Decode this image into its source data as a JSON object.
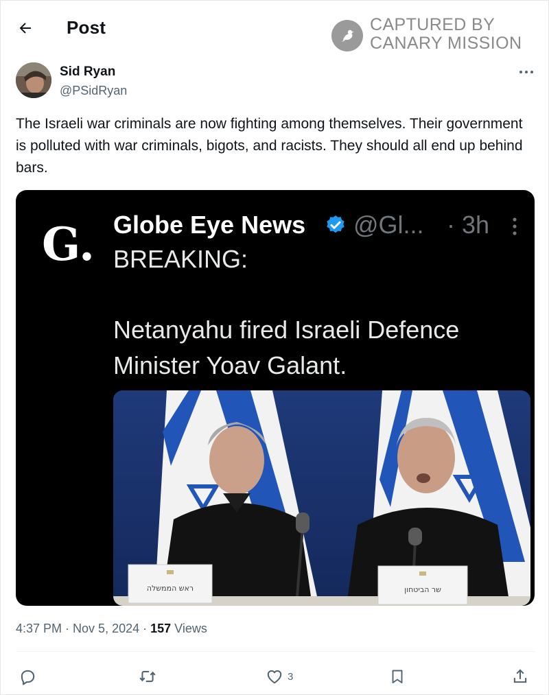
{
  "header": {
    "title": "Post",
    "back_icon": "arrow-left-icon"
  },
  "watermark": {
    "line1": "CAPTURED BY",
    "line2": "CANARY MISSION"
  },
  "author": {
    "name": "Sid Ryan",
    "handle": "@PSidRyan"
  },
  "post": {
    "text": "The Israeli war criminals are now fighting among themselves. Their government is polluted with  war criminals, bigots, and racists. They should all end up behind bars."
  },
  "embedded": {
    "logo": "G.",
    "name": "Globe Eye News",
    "handle": "@Gl...",
    "time": "· 3h",
    "breaking": "BREAKING:",
    "body": "Netanyahu fired Israeli Defence Minister Yoav Galant.",
    "placard_left": "ראש הממשלה",
    "placard_right": "שר הביטחון"
  },
  "meta": {
    "time": "4:37 PM",
    "sep1": " · ",
    "date": "Nov 5, 2024",
    "sep2": " · ",
    "views_count": "157",
    "views_label": " Views"
  },
  "actions": {
    "reply_count": "",
    "repost_count": "",
    "like_count": "3",
    "bookmark_count": "",
    "share_icon": "share-icon"
  },
  "colors": {
    "text": "#0f1419",
    "secondary": "#536471",
    "verified_blue": "#1d9bf0",
    "dark_text": "#e7e9ea",
    "watermark_gray": "#8a8a8a"
  }
}
